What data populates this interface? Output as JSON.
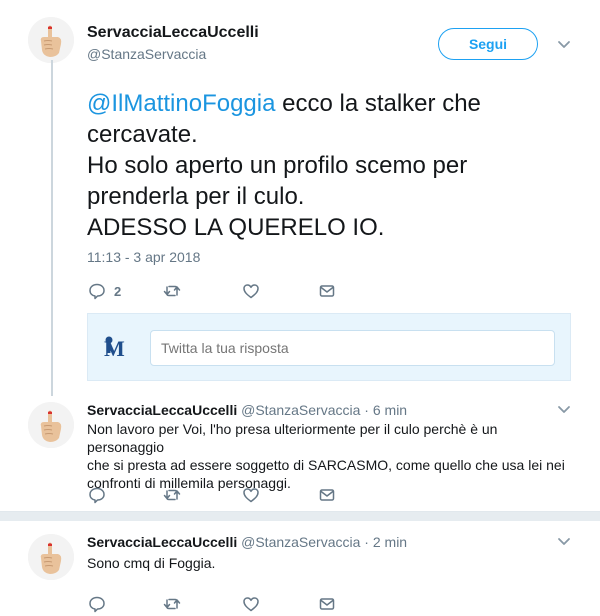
{
  "tweet": {
    "author_name": "ServacciaLeccaUccelli",
    "author_handle": "@StanzaServaccia",
    "follow_label": "Segui",
    "mention": "@IlMattinoFoggia",
    "text_line1_rest": " ecco la stalker che",
    "text_line2": "cercavate.",
    "text_line3": "Ho solo aperto un profilo scemo per",
    "text_line4": "prenderla per il culo.",
    "text_line5": "ADESSO LA QUERELO IO.",
    "timestamp": "11:13 - 3 apr 2018",
    "reply_count": "2"
  },
  "reply_box": {
    "placeholder": "Twitta la tua risposta"
  },
  "replies": [
    {
      "name": "ServacciaLeccaUccelli",
      "handle": "@StanzaServaccia",
      "sep": "·",
      "time": "6 min",
      "lines": [
        "Non lavoro per Voi, l'ho presa ulteriormente per il culo perchè è un personaggio",
        "che si presta ad essere soggetto di SARCASMO, come quello che usa lei nei",
        "confronti di millemila personaggi."
      ]
    },
    {
      "name": "ServacciaLeccaUccelli",
      "handle": "@StanzaServaccia",
      "sep": "·",
      "time": "2 min",
      "lines": [
        "Sono cmq di Foggia."
      ]
    }
  ],
  "icons": {
    "reply": "reply-icon",
    "retweet": "retweet-icon",
    "like": "heart-icon",
    "dm": "envelope-icon",
    "more": "chevron-down-icon"
  },
  "colors": {
    "accent": "#1da1f2",
    "mention": "#1b95e0",
    "muted": "#657786",
    "reply_bg": "#e8f5fd"
  }
}
